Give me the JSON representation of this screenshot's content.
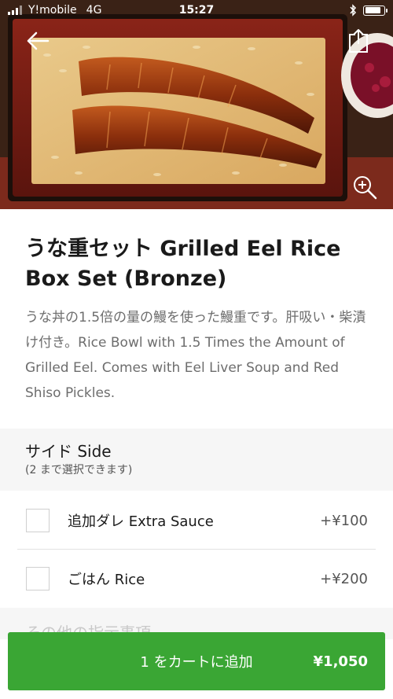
{
  "status_bar": {
    "carrier": "Y!mobile",
    "network": "4G",
    "time": "15:27",
    "battery_level": 0.85,
    "icons": [
      "signal-icon",
      "bluetooth-icon",
      "battery-icon"
    ]
  },
  "nav": {
    "back_icon": "back-arrow-icon",
    "share_icon": "share-icon",
    "zoom_icon": "zoom-in-icon"
  },
  "item": {
    "title": "うな重セット Grilled Eel Rice Box Set (Bronze)",
    "description": "うな丼の1.5倍の量の鰻を使った鰻重です。肝吸い・柴漬け付き。Rice Bowl with 1.5 Times the Amount of Grilled Eel. Comes with Eel Liver Soup and Red Shiso Pickles."
  },
  "options_section": {
    "title": "サイド Side",
    "subtitle": "(2 まで選択できます)",
    "options": [
      {
        "label": "追加ダレ Extra Sauce",
        "price": "+¥100",
        "checked": false
      },
      {
        "label": "ごはん Rice",
        "price": "+¥200",
        "checked": false
      }
    ]
  },
  "next_section": {
    "title": "その他の指示事項"
  },
  "cart_button": {
    "label": "1 をカートに追加",
    "total": "¥1,050"
  },
  "colors": {
    "accent_green": "#3aa634",
    "section_bg": "#f6f6f6"
  }
}
